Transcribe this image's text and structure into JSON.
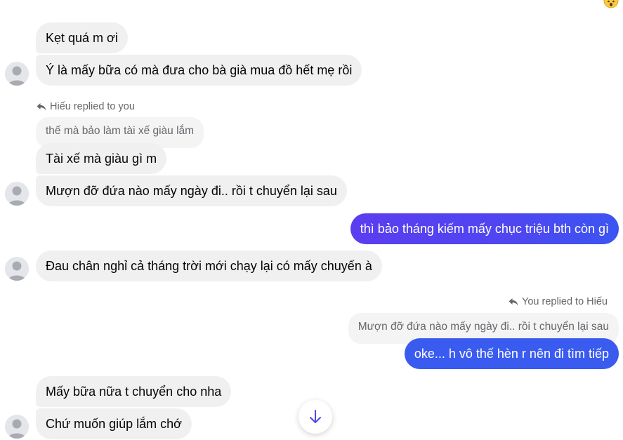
{
  "messages": [
    {
      "sender": "other",
      "text": "Kẹt quá m ơi"
    },
    {
      "sender": "other",
      "text": "Ý là mấy bữa có mà đưa cho bà già mua đồ hết mẹ rồi"
    },
    {
      "sender": "other",
      "reply_header": "Hiếu replied to you",
      "quoted": "thế mà bảo làm tài xế giàu lắm",
      "text": "Tài xế mà giàu gì m"
    },
    {
      "sender": "other",
      "text": "Mượn đỡ đứa nào mấy ngày đi.. rồi t chuyển lại sau"
    },
    {
      "sender": "me",
      "text": "thì bảo tháng kiếm mấy chục triệu bth còn gì"
    },
    {
      "sender": "other",
      "text": "Đau chân nghỉ cả tháng trời mới chạy lại có mấy chuyến à"
    },
    {
      "sender": "me",
      "reply_header": "You replied to Hiếu",
      "quoted": "Mượn đỡ đứa nào mấy ngày đi.. rồi t chuyển lại sau",
      "text": "oke... h vô thế hèn r nên đi tìm tiếp"
    },
    {
      "sender": "other",
      "text": "Mấy bữa nữa t chuyển cho nha"
    },
    {
      "sender": "other",
      "text": "Chứ muốn giúp lắm chớ"
    }
  ],
  "icons": {
    "reply": "reply-arrow-icon",
    "avatar": "default-avatar-icon",
    "scroll": "arrow-down-icon",
    "reaction": "wow-emoji-icon"
  },
  "colors": {
    "incoming_bubble": "#f0f0f0",
    "outgoing_bubble": "#4f46f0",
    "outgoing_bubble_blue": "#3a5bf0",
    "scroll_arrow": "#4f46e5"
  }
}
